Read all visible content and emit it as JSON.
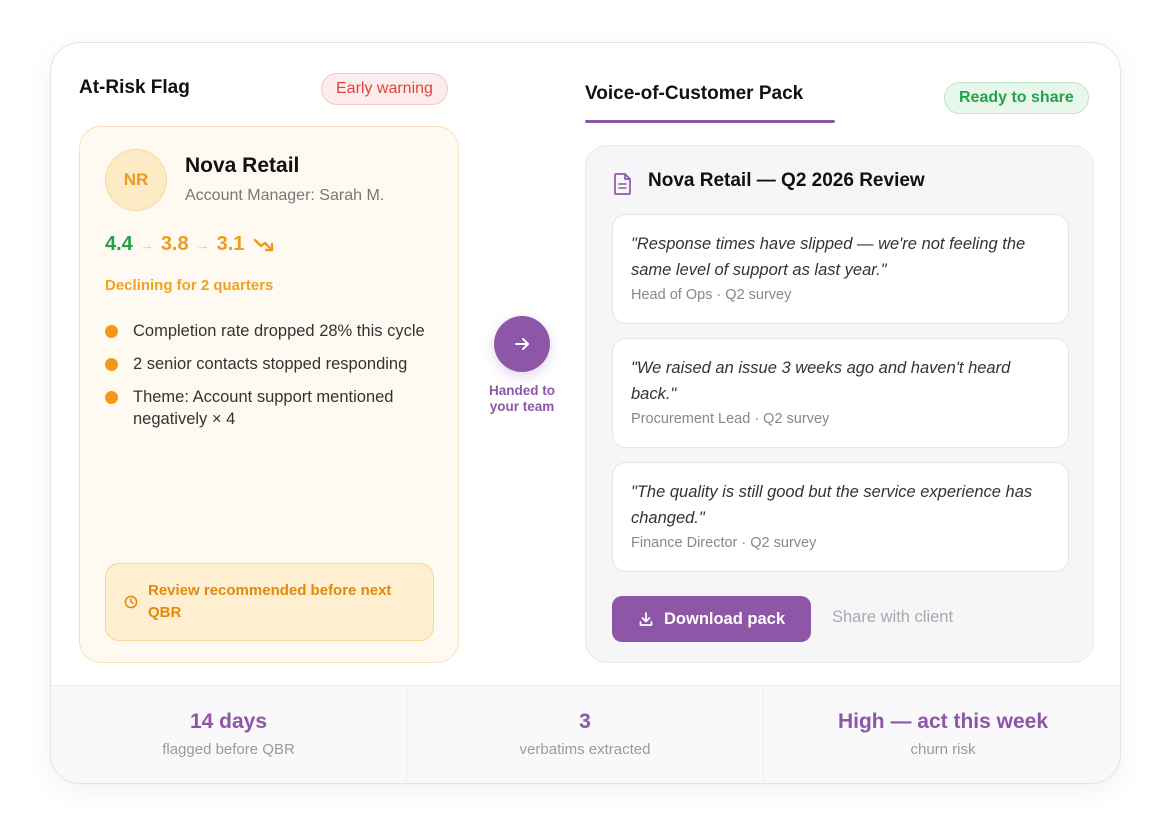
{
  "at_risk": {
    "title": "At-Risk Flag",
    "badge": "Early warning",
    "account": {
      "initials": "NR",
      "name": "Nova Retail",
      "manager": "Account Manager: Sarah M."
    },
    "trend": {
      "values": [
        "4.4",
        "3.8",
        "3.1"
      ],
      "separator": "→"
    },
    "trend_note": "Declining for 2 quarters",
    "signals": [
      "Completion rate dropped 28% this cycle",
      "2 senior contacts stopped responding",
      "Theme: Account support mentioned negatively × 4"
    ],
    "recommendation": "Review recommended before next QBR"
  },
  "handoff": {
    "label": "Handed to your team"
  },
  "voc": {
    "tab_title": "Voice-of-Customer Pack",
    "badge": "Ready to share",
    "pack_title": "Nova Retail — Q2 2026 Review",
    "quotes": [
      {
        "text": "\"Response times have slipped — we're not feeling the same level of support as last year.\"",
        "source": "Head of Ops · Q2 survey"
      },
      {
        "text": "\"We raised an issue 3 weeks ago and haven't heard back.\"",
        "source": "Procurement Lead · Q2 survey"
      },
      {
        "text": "\"The quality is still good but the service experience has changed.\"",
        "source": "Finance Director · Q2 survey"
      }
    ],
    "download_label": "Download pack",
    "share_label": "Share with client"
  },
  "stats": [
    {
      "value": "14 days",
      "label": "flagged before QBR"
    },
    {
      "value": "3",
      "label": "verbatims extracted"
    },
    {
      "value": "High — act this week",
      "label": "churn risk"
    }
  ],
  "colors": {
    "accent": "#8e56a6",
    "warning": "#e0443e",
    "success": "#23a24a",
    "amber": "#ef9b1e"
  },
  "icons": {
    "trend": "trend-down-icon",
    "clock": "clock-icon",
    "handoff": "arrow-right-icon",
    "document": "document-icon",
    "download": "download-icon"
  }
}
